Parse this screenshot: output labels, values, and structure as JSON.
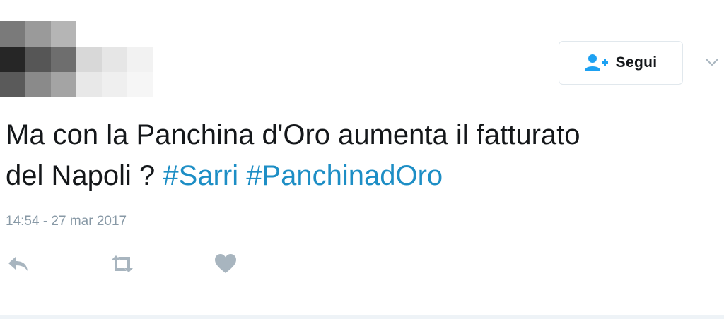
{
  "follow_button": {
    "label": "Segui",
    "icon": "add-user-icon"
  },
  "dropdown": {
    "icon": "chevron-down-icon"
  },
  "tweet": {
    "text_line1": "Ma con la Panchina d'Oro aumenta il fatturato",
    "text_line2_prefix": "del Napoli ? ",
    "hashtag1": "#Sarri",
    "hashtag2": "#PanchinadOro",
    "timestamp": "14:54 - 27 mar 2017"
  },
  "actions": [
    {
      "icon": "reply-icon"
    },
    {
      "icon": "retweet-icon"
    },
    {
      "icon": "like-icon"
    }
  ],
  "colors": {
    "text": "#14171a",
    "hashtag": "#1d8ec5",
    "muted": "#8899a6",
    "accent": "#1da1f2"
  }
}
